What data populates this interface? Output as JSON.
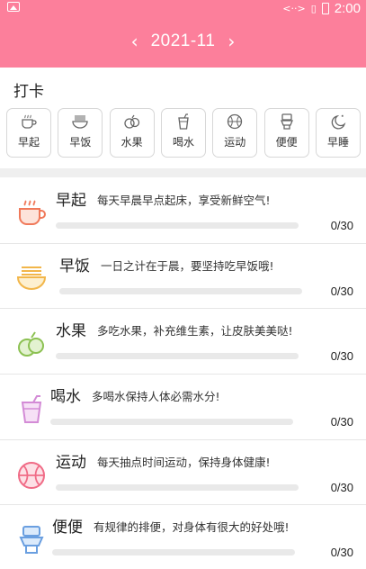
{
  "status_bar": {
    "time": "2:00",
    "indicators": "<··>"
  },
  "header": {
    "month": "2021-11",
    "prev": "‹",
    "next": "›",
    "bg_color": "#fc7f9b"
  },
  "checkin": {
    "title": "打卡",
    "habits": [
      {
        "label": "早起",
        "icon": "coffee-cup-icon"
      },
      {
        "label": "早饭",
        "icon": "noodle-bowl-icon"
      },
      {
        "label": "水果",
        "icon": "fruit-icon"
      },
      {
        "label": "喝水",
        "icon": "water-cup-icon"
      },
      {
        "label": "运动",
        "icon": "ball-icon"
      },
      {
        "label": "便便",
        "icon": "toilet-icon"
      },
      {
        "label": "早睡",
        "icon": "moon-icon"
      }
    ]
  },
  "list": [
    {
      "name": "早起",
      "desc": "每天早晨早点起床，享受新鲜空气!",
      "count": "0/30",
      "progress": 0,
      "icon": "coffee-cup-icon"
    },
    {
      "name": "早饭",
      "desc": "一日之计在于晨，要坚持吃早饭哦!",
      "count": "0/30",
      "progress": 0,
      "icon": "noodle-bowl-icon"
    },
    {
      "name": "水果",
      "desc": "多吃水果，补充维生素，让皮肤美美哒!",
      "count": "0/30",
      "progress": 0,
      "icon": "fruit-icon"
    },
    {
      "name": "喝水",
      "desc": "多喝水保持人体必需水分!",
      "count": "0/30",
      "progress": 0,
      "icon": "water-cup-icon"
    },
    {
      "name": "运动",
      "desc": "每天抽点时间运动，保持身体健康!",
      "count": "0/30",
      "progress": 0,
      "icon": "ball-icon"
    },
    {
      "name": "便便",
      "desc": "有规律的排便，对身体有很大的好处哦!",
      "count": "0/30",
      "progress": 0,
      "icon": "toilet-icon"
    }
  ]
}
